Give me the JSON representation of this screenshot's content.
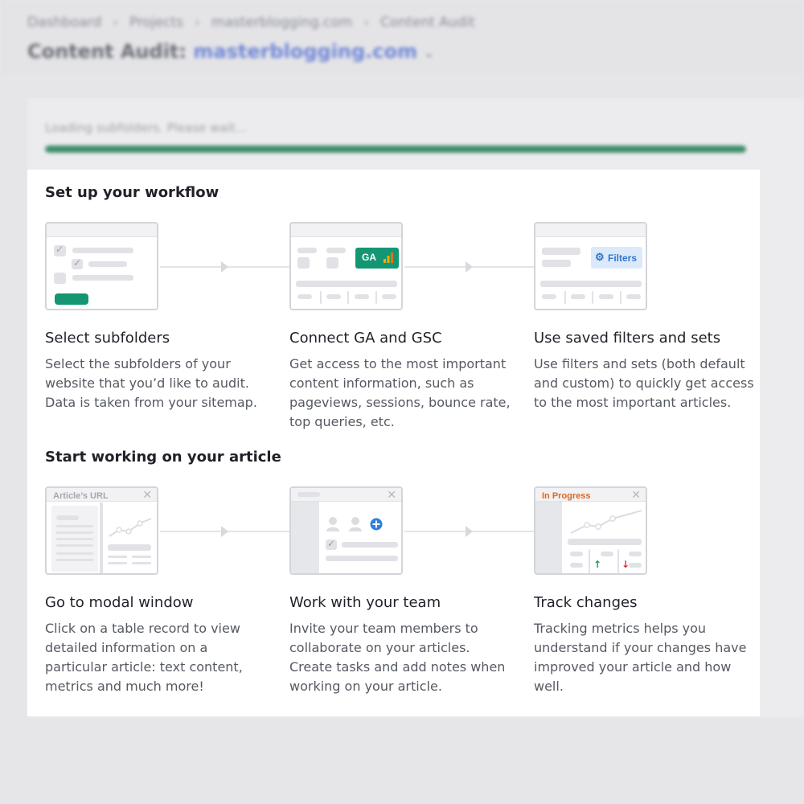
{
  "breadcrumb": [
    "Dashboard",
    "Projects",
    "masterblogging.com",
    "Content Audit"
  ],
  "page_title": {
    "prefix": "Content Audit:",
    "domain": "masterblogging.com"
  },
  "loading": {
    "text": "Loading subfolders. Please wait...",
    "progress": 1.0
  },
  "colors": {
    "accent_green": "#149672",
    "progress_green": "#3c8d68",
    "link_blue": "#6f86d6",
    "in_progress_orange": "#e0661f"
  },
  "workflow": {
    "title": "Set up your workflow",
    "steps": [
      {
        "title": "Select subfolders",
        "description": "Select the subfolders of your website that you’d like to audit. Data is taken from your sitemap."
      },
      {
        "title": "Connect GA and GSC",
        "description": "Get access to the most important content information, such as pageviews, sessions, bounce rate, top queries, etc.",
        "badge": "GA"
      },
      {
        "title": "Use saved filters and sets",
        "description": "Use filters and sets (both default and custom) to quickly get access to the most important articles.",
        "button": "Filters"
      }
    ]
  },
  "article": {
    "title": "Start working on your article",
    "steps": [
      {
        "title": "Go to modal window",
        "description": "Click on a table record to view detailed information on a particular article: text content, metrics and much more!",
        "label": "Article’s URL"
      },
      {
        "title": "Work with your team",
        "description": "Invite your team members to collaborate on your articles. Create tasks and add notes when working on your article."
      },
      {
        "title": "Track changes",
        "description": "Tracking metrics helps you understand if your changes have improved your article and how well.",
        "label": "In Progress"
      }
    ]
  }
}
